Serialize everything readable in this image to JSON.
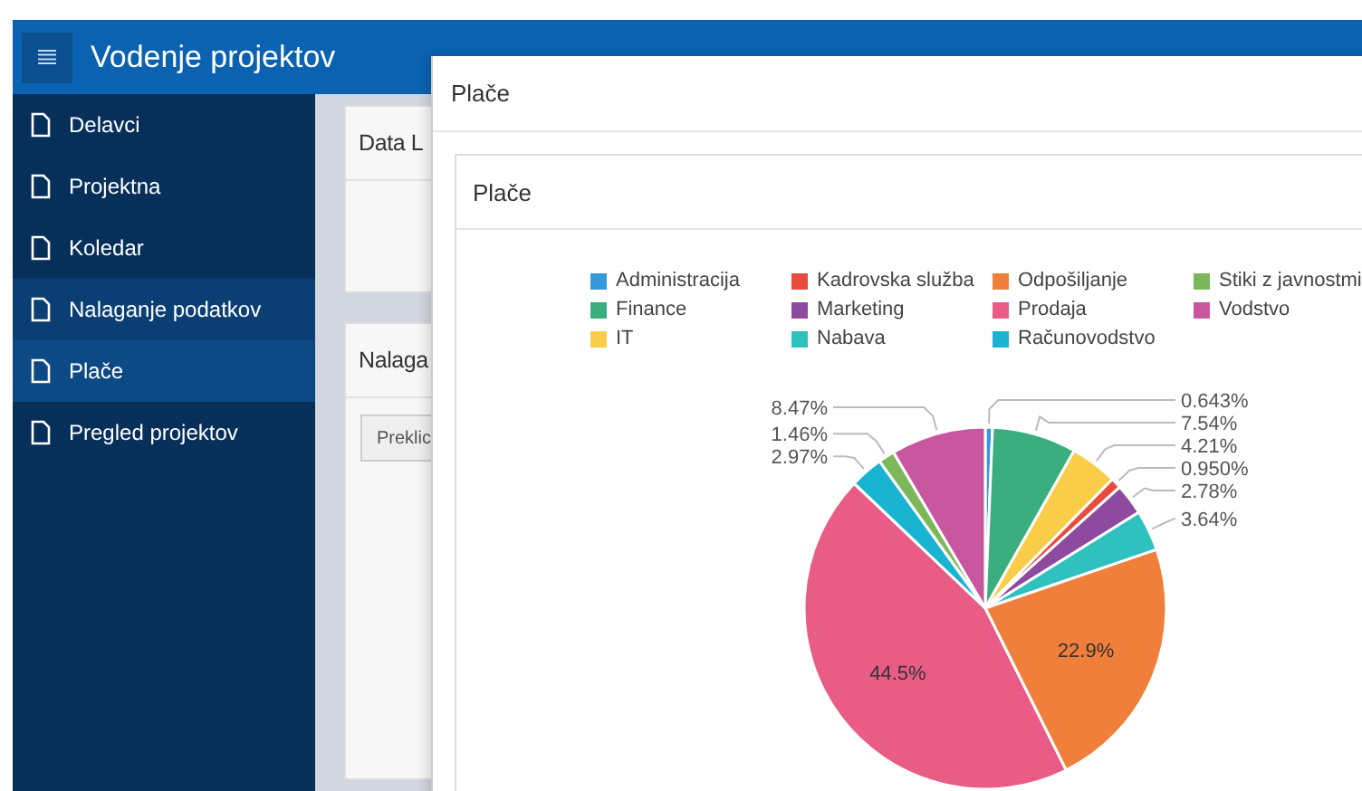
{
  "header": {
    "title": "Vodenje projektov"
  },
  "sidebar": {
    "items": [
      {
        "label": "Delavci",
        "selected": false,
        "hovered": false
      },
      {
        "label": "Projektna",
        "selected": false,
        "hovered": false
      },
      {
        "label": "Koledar",
        "selected": false,
        "hovered": false
      },
      {
        "label": "Nalaganje podatkov",
        "selected": false,
        "hovered": true
      },
      {
        "label": "Plače",
        "selected": true,
        "hovered": false
      },
      {
        "label": "Pregled projektov",
        "selected": false,
        "hovered": false
      }
    ]
  },
  "background_cards": [
    {
      "title": "Data L"
    },
    {
      "title": "Nalaga",
      "button": "Preklic"
    }
  ],
  "modal": {
    "title": "Plače",
    "card": {
      "title": "Plače",
      "legend": [
        {
          "color": "#3498db"
        },
        {
          "color": "#3aae7e"
        },
        {
          "color": "#f9cd48"
        },
        {
          "color": "#e74c3c"
        },
        {
          "color": "#8e4a9e"
        },
        {
          "color": "#2fc1be"
        },
        {
          "color": "#ef7f3a"
        },
        {
          "color": "#e85c85"
        },
        {
          "color": "#19b4d1"
        },
        {
          "color": "#7cb85a"
        },
        {
          "color": "#c857a0"
        }
      ],
      "chart_data": {
        "type": "pie",
        "categories": [
          "Administracija",
          "Finance",
          "IT",
          "Kadrovska služba",
          "Marketing",
          "Nabava",
          "Odpošiljanje",
          "Prodaja",
          "Računovodstvo",
          "Stiki z javnostmi",
          "Vodstvo"
        ],
        "values": [
          0.643,
          7.54,
          4.21,
          0.95,
          2.78,
          3.64,
          22.9,
          44.5,
          2.97,
          1.46,
          8.47
        ],
        "value_labels": [
          "0.643%",
          "7.54%",
          "4.21%",
          "0.950%",
          "2.78%",
          "3.64%",
          "22.9%",
          "44.5%",
          "2.97%",
          "1.46%",
          "8.47%"
        ]
      }
    }
  }
}
